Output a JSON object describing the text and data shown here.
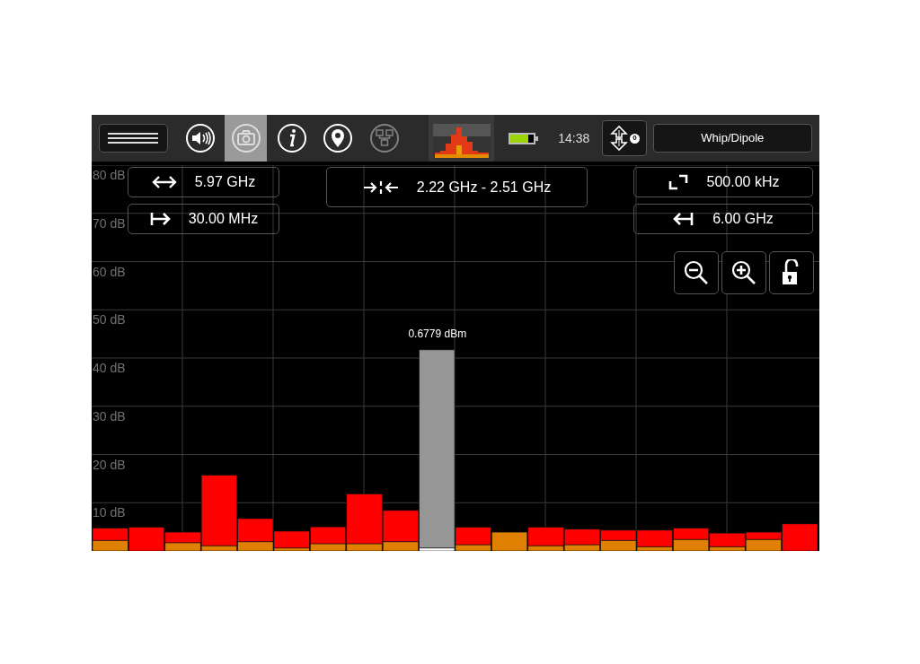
{
  "toolbar": {
    "menu_button": {
      "kind": "menu"
    },
    "icons": [
      {
        "kind": "speaker",
        "selected": false,
        "disabled": false
      },
      {
        "kind": "camera",
        "selected": true,
        "disabled": false
      },
      {
        "kind": "info",
        "selected": false,
        "disabled": false
      },
      {
        "kind": "location",
        "selected": false,
        "disabled": false
      },
      {
        "kind": "network",
        "selected": false,
        "disabled": true
      }
    ],
    "battery": {
      "level": 0.75
    },
    "time": "14:38",
    "antenna_badge": "0",
    "antenna_button": "Whip/Dipole"
  },
  "frequency_controls": [
    {
      "kind": "span",
      "value": "5.97 GHz"
    },
    {
      "kind": "start",
      "value": "30.00 MHz"
    },
    {
      "kind": "center",
      "value": "2.22 GHz - 2.51 GHz"
    },
    {
      "kind": "rbw",
      "value": "500.00 kHz"
    },
    {
      "kind": "stop",
      "value": "6.00 GHz"
    }
  ],
  "view_buttons": [
    {
      "kind": "zoom_out"
    },
    {
      "kind": "zoom_in"
    },
    {
      "kind": "lock",
      "locked": false
    }
  ],
  "spectrum": {
    "marker_reading": "0.6779 dBm",
    "chart_data": {
      "type": "bar",
      "ylim": [
        0,
        80
      ],
      "yticks": [
        {
          "value": 10,
          "label": "10 dB"
        },
        {
          "value": 20,
          "label": "20 dB"
        },
        {
          "value": 30,
          "label": "30 dB"
        },
        {
          "value": 40,
          "label": "40 dB"
        },
        {
          "value": 50,
          "label": "50 dB"
        },
        {
          "value": 60,
          "label": "60 dB"
        },
        {
          "value": 70,
          "label": "70 dB"
        },
        {
          "value": 80,
          "label": "80 dB"
        }
      ],
      "grid": true,
      "stacked": true,
      "series": [
        {
          "color": "#e08000",
          "values": [
            2.2,
            0,
            1.7,
            1.1,
            1.9,
            0.6,
            1.5,
            1.5,
            1.9,
            null,
            1.3,
            3.9,
            1.1,
            1.3,
            2.2,
            0.9,
            2.4,
            0.9,
            2.4,
            0
          ]
        },
        {
          "color": "#ff0000",
          "values": [
            2.5,
            4.9,
            2.2,
            14.6,
            4.8,
            3.5,
            3.5,
            10.3,
            6.5,
            null,
            3.6,
            0,
            3.8,
            3.2,
            2.1,
            3.4,
            2.3,
            2.8,
            1.5,
            5.6
          ]
        },
        {
          "color": "#ffffff",
          "values": [
            null,
            null,
            null,
            null,
            null,
            null,
            null,
            null,
            null,
            0.6,
            null,
            null,
            null,
            null,
            null,
            null,
            null,
            null,
            null,
            null
          ]
        },
        {
          "color": "#969696",
          "values": [
            null,
            null,
            null,
            null,
            null,
            null,
            null,
            null,
            null,
            41.1,
            null,
            null,
            null,
            null,
            null,
            null,
            null,
            null,
            null,
            null
          ]
        }
      ]
    }
  }
}
